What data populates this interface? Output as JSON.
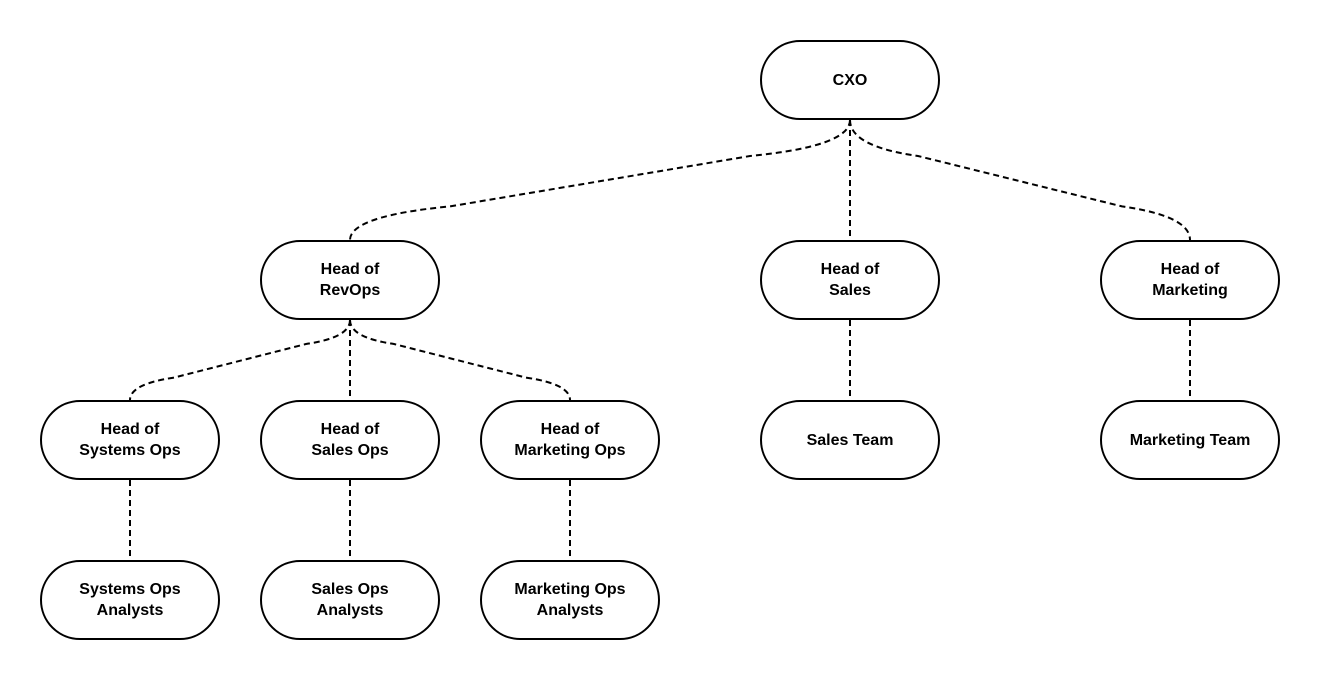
{
  "nodes": {
    "cxo": [
      "CXO"
    ],
    "head_revops": [
      "Head of",
      "RevOps"
    ],
    "head_sales": [
      "Head of",
      "Sales"
    ],
    "head_marketing": [
      "Head of",
      "Marketing"
    ],
    "head_systems_ops": [
      "Head of",
      "Systems Ops"
    ],
    "head_sales_ops": [
      "Head of",
      "Sales Ops"
    ],
    "head_marketing_ops": [
      "Head of",
      "Marketing Ops"
    ],
    "sales_team": [
      "Sales Team"
    ],
    "marketing_team": [
      "Marketing Team"
    ],
    "systems_ops_analysts": [
      "Systems Ops",
      "Analysts"
    ],
    "sales_ops_analysts": [
      "Sales Ops",
      "Analysts"
    ],
    "marketing_ops_analysts": [
      "Marketing Ops",
      "Analysts"
    ]
  },
  "edges": [
    [
      "cxo",
      "head_revops"
    ],
    [
      "cxo",
      "head_sales"
    ],
    [
      "cxo",
      "head_marketing"
    ],
    [
      "head_revops",
      "head_systems_ops"
    ],
    [
      "head_revops",
      "head_sales_ops"
    ],
    [
      "head_revops",
      "head_marketing_ops"
    ],
    [
      "head_sales",
      "sales_team"
    ],
    [
      "head_marketing",
      "marketing_team"
    ],
    [
      "head_systems_ops",
      "systems_ops_analysts"
    ],
    [
      "head_sales_ops",
      "sales_ops_analysts"
    ],
    [
      "head_marketing_ops",
      "marketing_ops_analysts"
    ]
  ],
  "style": {
    "line": "dashed",
    "stroke_color": "#000000",
    "node_fill": "#ffffff"
  }
}
